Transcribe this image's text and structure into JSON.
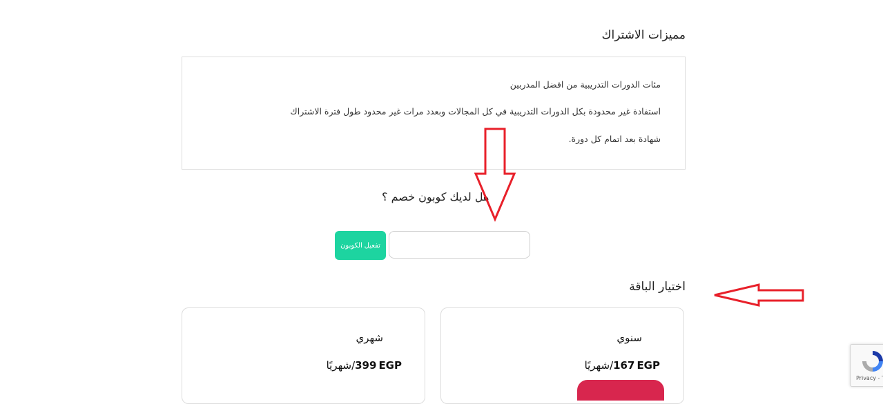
{
  "features": {
    "title": "مميزات الاشتراك",
    "items": [
      "مئات الدورات التدريبية من افضل المدربين",
      "استفادة غير محدودة بكل الدورات التدريبية في كل المجالات وبعدد مرات غير محدود طول فترة الاشتراك",
      "شهادة بعد اتمام كل دورة."
    ]
  },
  "coupon": {
    "question": "هل لديك كوبون خصم ؟",
    "input_value": "",
    "input_placeholder": "",
    "button_label": "تفعيل الكوبون"
  },
  "packages": {
    "title": "اختيار الباقة",
    "plans": [
      {
        "name": "شهري",
        "price": "399",
        "currency": "EGP",
        "period": "/شهريًا"
      },
      {
        "name": "سنوي",
        "price": "167",
        "currency": "EGP",
        "period": "/شهريًا"
      }
    ]
  },
  "recaptcha": {
    "text": "Privacy - Te"
  },
  "annotations": {
    "arrow_color": "#e8202a"
  },
  "colors": {
    "coupon_button": "#1dd4a0",
    "subscribe_button": "#d8264e"
  }
}
